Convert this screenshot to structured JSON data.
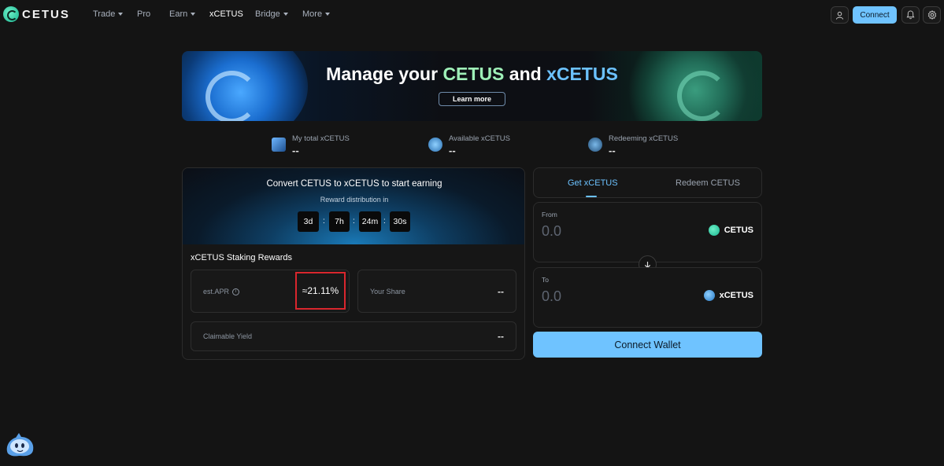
{
  "nav": {
    "brand": "CETUS",
    "items": [
      {
        "label": "Trade",
        "dropdown": true
      },
      {
        "label": "Pro",
        "dropdown": false
      },
      {
        "label": "Earn",
        "dropdown": true
      },
      {
        "label": "xCETUS",
        "dropdown": false,
        "active": true
      },
      {
        "label": "Bridge",
        "dropdown": true
      },
      {
        "label": "More",
        "dropdown": true
      }
    ],
    "connect_label": "Connect",
    "icons": [
      "user-icon",
      "bell-icon",
      "gear-icon"
    ]
  },
  "banner": {
    "title_prefix": "Manage your ",
    "title_cetus": "CETUS",
    "title_and": " and ",
    "title_xcetus": "xCETUS",
    "learn_more": "Learn more"
  },
  "stats": [
    {
      "label": "My total xCETUS",
      "value": "--"
    },
    {
      "label": "Available xCETUS",
      "value": "--"
    },
    {
      "label": "Redeeming xCETUS",
      "value": "--"
    }
  ],
  "hero": {
    "title": "Convert CETUS to xCETUS to start earning",
    "subtitle": "Reward distribution in",
    "countdown": {
      "days": "3d",
      "hours": "7h",
      "minutes": "24m",
      "seconds": "30s"
    }
  },
  "staking": {
    "title": "xCETUS Staking Rewards",
    "apr_label": "est.APR",
    "apr_value": "≈21.11%",
    "share_label": "Your Share",
    "share_value": "--",
    "yield_label": "Claimable Yield",
    "yield_value": "--"
  },
  "swap": {
    "tabs": [
      {
        "label": "Get xCETUS",
        "active": true
      },
      {
        "label": "Redeem CETUS",
        "active": false
      }
    ],
    "from": {
      "label": "From",
      "amount": "0.0",
      "token": "CETUS"
    },
    "to": {
      "label": "To",
      "amount": "0.0",
      "token": "xCETUS"
    },
    "connect_wallet": "Connect Wallet"
  },
  "colors": {
    "accent": "#6fc3ff",
    "green": "#9ff0b8",
    "highlight_border": "#d9262d"
  }
}
